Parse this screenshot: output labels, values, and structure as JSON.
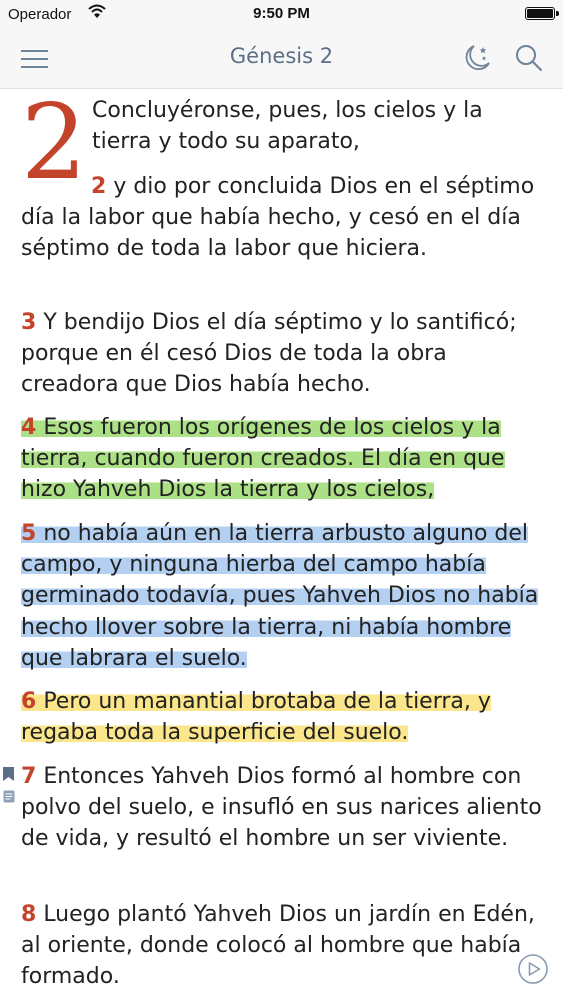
{
  "status_bar": {
    "carrier": "Operador",
    "time": "9:50 PM"
  },
  "nav": {
    "title": "Génesis 2"
  },
  "chapter": {
    "number": "2"
  },
  "verses": [
    {
      "number": "",
      "text": "Concluyéronse, pues, los cielos y la tierra y todo su aparato,",
      "highlight": "none"
    },
    {
      "number": "2",
      "text": "y dio por concluida Dios en el séptimo día la labor que había hecho, y cesó en el día séptimo de toda la labor que hiciera.",
      "highlight": "none"
    },
    {
      "number": "3",
      "text": "Y bendijo Dios el día séptimo y lo santificó; porque en él cesó Dios de toda la obra creadora que Dios había hecho.",
      "highlight": "none"
    },
    {
      "number": "4",
      "text": "Esos fueron los orígenes de los cielos y la tierra, cuando fueron creados. El día en que hizo Yahveh Dios la tierra y los cielos,",
      "highlight": "green"
    },
    {
      "number": "5",
      "text": "no había aún en la tierra arbusto alguno del campo, y ninguna hierba del campo había germinado todavía, pues Yahveh Dios no había hecho llover sobre la tierra, ni había hombre que labrara el suelo.",
      "highlight": "blue"
    },
    {
      "number": "6",
      "text": "Pero un manantial brotaba de la tierra, y regaba toda la superficie del suelo.",
      "highlight": "yellow"
    },
    {
      "number": "7",
      "text": "Entonces Yahveh Dios formó al hombre con polvo del suelo, e insufló en sus narices aliento de vida, y resultó el hombre un ser viviente.",
      "highlight": "none"
    },
    {
      "number": "8",
      "text": "Luego plantó Yahveh Dios un jardín en Edén, al oriente, donde colocó al hombre que había formado.",
      "highlight": "none"
    }
  ],
  "icons": {
    "menu": "hamburger-menu-icon",
    "night_mode": "moon-stars-icon",
    "search": "search-icon",
    "bookmark": "bookmark-icon",
    "note": "note-icon",
    "play": "play-audio-icon"
  },
  "colors": {
    "accent": "#5b6f86",
    "verse_number": "#c4442b",
    "highlight_green": "#95d864",
    "highlight_blue": "#a0c4ee",
    "highlight_yellow": "#fae06e",
    "bookmark": "#5a6f86"
  }
}
